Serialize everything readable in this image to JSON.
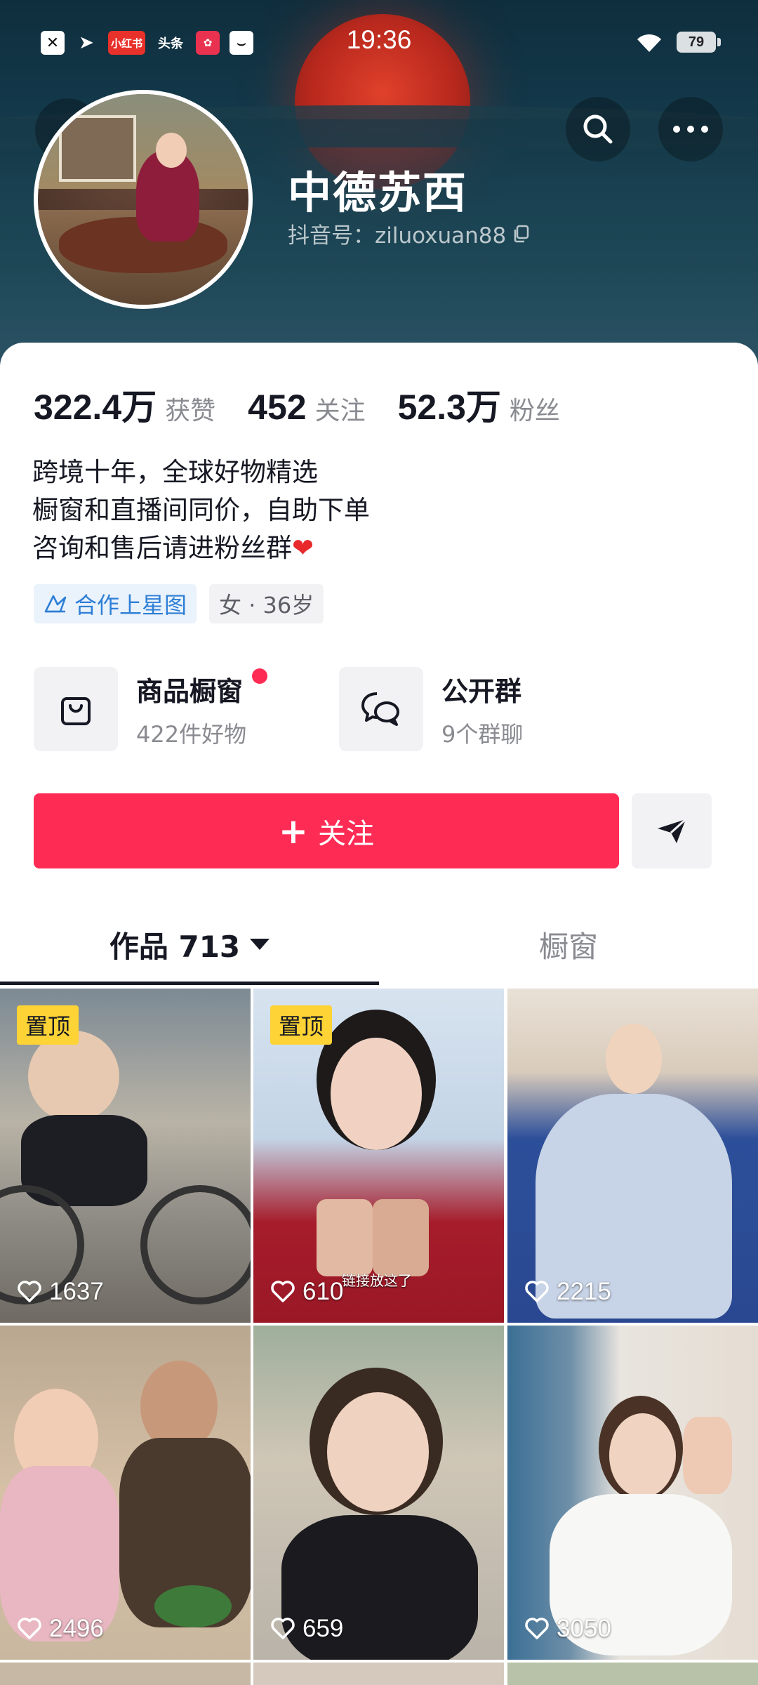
{
  "status_bar": {
    "time": "19:36",
    "battery": "79",
    "apps": [
      "x-app",
      "telegram",
      "小红书",
      "头条",
      "pink-app",
      "message"
    ]
  },
  "status_apps": {
    "red_label": "小红书",
    "toutiao_label": "头条"
  },
  "profile": {
    "name": "中德苏西",
    "douyin_id": "抖音号：ziluoxuan88"
  },
  "stats": [
    {
      "value": "322.4万",
      "label": "获赞"
    },
    {
      "value": "452",
      "label": "关注"
    },
    {
      "value": "52.3万",
      "label": "粉丝"
    }
  ],
  "bio": {
    "line1": "跨境十年，全球好物精选",
    "line2": "橱窗和直播间同价，自助下单",
    "line3": "咨询和售后请进粉丝群",
    "heart": "❤"
  },
  "tags": {
    "cooperation": "合作上星图",
    "info": "女 · 36岁"
  },
  "features": {
    "shop": {
      "title": "商品橱窗",
      "subtitle": "422件好物"
    },
    "group": {
      "title": "公开群",
      "subtitle": "9个群聊"
    }
  },
  "actions": {
    "follow_plus": "+",
    "follow_label": "关注"
  },
  "tabs": {
    "works": "作品 713",
    "showcase": "橱窗"
  },
  "grid": {
    "pinned_label": "置顶",
    "caption_2": "链接放这了",
    "likes": [
      "1637",
      "610",
      "2215",
      "2496",
      "659",
      "3050"
    ]
  },
  "colors": {
    "accent": "#fe2c55",
    "pinned": "#fdd335",
    "tag_blue": "#2d7fd6"
  }
}
